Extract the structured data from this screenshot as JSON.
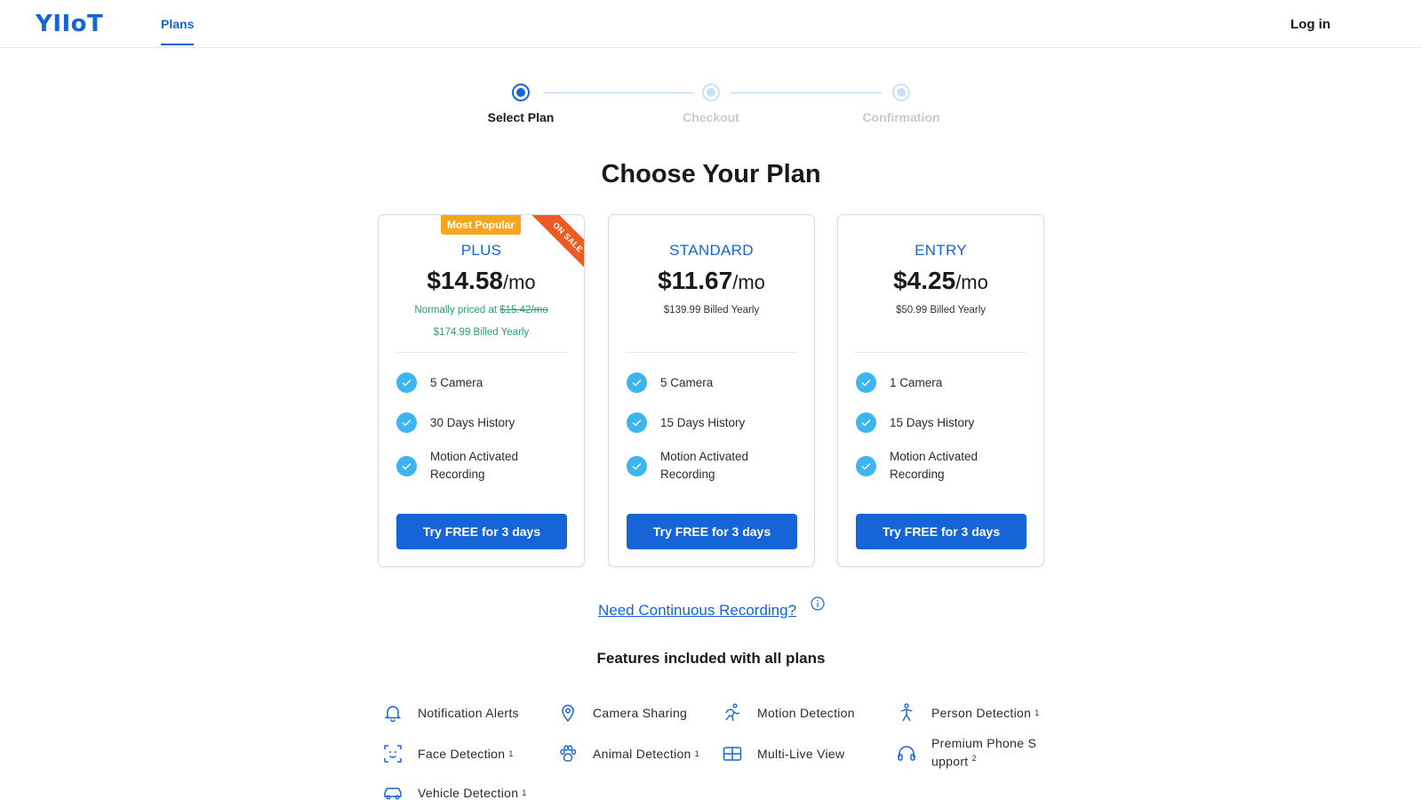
{
  "header": {
    "logo": "YIIoT",
    "nav_plans": "Plans",
    "login": "Log in"
  },
  "stepper": {
    "steps": [
      {
        "label": "Select Plan",
        "state": "active"
      },
      {
        "label": "Checkout",
        "state": "pending"
      },
      {
        "label": "Confirmation",
        "state": "pending"
      }
    ]
  },
  "title": "Choose Your Plan",
  "plans": [
    {
      "name": "PLUS",
      "badge": "Most Popular",
      "ribbon": "ON SALE",
      "price": "$14.58",
      "per": "/mo",
      "normally_prefix": "Normally priced at ",
      "normally_price": "$15.42/mo",
      "billed": "$174.99 Billed Yearly",
      "features": [
        "5 Camera",
        "30 Days History",
        "Motion Activated Recording"
      ],
      "cta": "Try FREE for 3 days"
    },
    {
      "name": "STANDARD",
      "price": "$11.67",
      "per": "/mo",
      "billed": "$139.99 Billed Yearly",
      "features": [
        "5 Camera",
        "15 Days History",
        "Motion Activated Recording"
      ],
      "cta": "Try FREE for 3 days"
    },
    {
      "name": "ENTRY",
      "price": "$4.25",
      "per": "/mo",
      "billed": "$50.99 Billed Yearly",
      "features": [
        "1 Camera",
        "15 Days History",
        "Motion Activated Recording"
      ],
      "cta": "Try FREE for 3 days"
    }
  ],
  "continuous_link": "Need Continuous Recording?",
  "features_title": "Features included with all plans",
  "all_features": [
    {
      "label": "Notification Alerts",
      "sup": "",
      "icon": "bell-icon"
    },
    {
      "label": "Camera Sharing",
      "sup": "",
      "icon": "location-pin-icon"
    },
    {
      "label": "Motion Detection",
      "sup": "",
      "icon": "running-person-icon"
    },
    {
      "label": "Person Detection",
      "sup": "1",
      "icon": "person-icon"
    },
    {
      "label": "Face Detection",
      "sup": "1",
      "icon": "face-scan-icon"
    },
    {
      "label": "Animal Detection",
      "sup": "1",
      "icon": "paw-icon"
    },
    {
      "label": "Multi-Live View",
      "sup": "",
      "icon": "grid-view-icon"
    },
    {
      "label": "Premium Phone S upport",
      "sup": "2",
      "icon": "headset-icon"
    },
    {
      "label": "Vehicle Detection",
      "sup": "1",
      "icon": "car-icon"
    }
  ],
  "colors": {
    "brand": "#1565d8",
    "check": "#3db5f0",
    "popular": "#f7a51c",
    "ribbon": "#ee5a24",
    "sale_text": "#27a36a"
  }
}
